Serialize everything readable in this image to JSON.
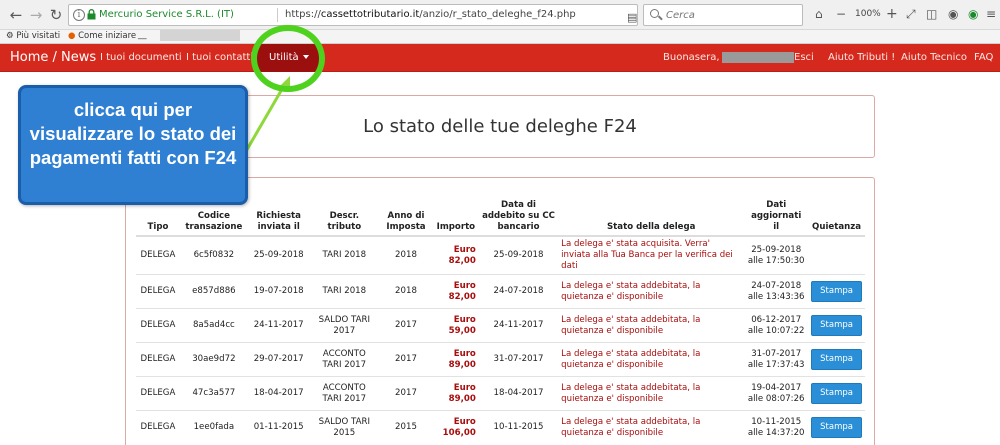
{
  "browser": {
    "site_identity": "Mercurio Service S.R.L. (IT)",
    "url_prefix": "https://",
    "url_host": "cassettotributario.it",
    "url_path": "/anzio/r_stato_deleghe_f24.php",
    "search_placeholder": "Cerca",
    "zoom": "100%",
    "bookmarks": [
      "Più visitati",
      "Come iniziare"
    ]
  },
  "navbar": {
    "brand": "Home / News",
    "documenti": "I tuoi documenti",
    "contatti": "I tuoi contatti",
    "utilita": "Utilità",
    "greeting": "Buonasera,",
    "esci": "Esci",
    "aiuto_tributi": "Aiuto Tributi !",
    "aiuto_tecnico": "Aiuto Tecnico",
    "faq": "FAQ"
  },
  "page": {
    "title": "Lo stato delle tue deleghe F24"
  },
  "table": {
    "headers": [
      "Tipo",
      "Codice transazione",
      "Richiesta inviata il",
      "Descr. tributo",
      "Anno di Imposta",
      "Importo",
      "Data di addebito su CC bancario",
      "Stato della delega",
      "Dati aggiornati il",
      "Quietanza"
    ],
    "button_label": "Stampa",
    "rows": [
      {
        "tipo": "DELEGA",
        "codice": "6c5f0832",
        "richiesta": "25-09-2018",
        "descr": "TARI 2018",
        "anno": "2018",
        "importo_1": "Euro",
        "importo_2": "82,00",
        "addebito": "25-09-2018",
        "stato": "La delega e' stata acquisita. Verra' inviata alla Tua Banca per la verifica dei dati",
        "agg_1": "25-09-2018",
        "agg_2": "alle 17:50:30",
        "stampa": false
      },
      {
        "tipo": "DELEGA",
        "codice": "e857d886",
        "richiesta": "19-07-2018",
        "descr": "TARI 2018",
        "anno": "2018",
        "importo_1": "Euro",
        "importo_2": "82,00",
        "addebito": "24-07-2018",
        "stato": "La delega e' stata addebitata, la quietanza e' disponibile",
        "agg_1": "24-07-2018",
        "agg_2": "alle 13:43:36",
        "stampa": true
      },
      {
        "tipo": "DELEGA",
        "codice": "8a5ad4cc",
        "richiesta": "24-11-2017",
        "descr": "SALDO TARI 2017",
        "anno": "2017",
        "importo_1": "Euro",
        "importo_2": "59,00",
        "addebito": "24-11-2017",
        "stato": "La delega e' stata addebitata, la quietanza e' disponibile",
        "agg_1": "06-12-2017",
        "agg_2": "alle 10:07:22",
        "stampa": true
      },
      {
        "tipo": "DELEGA",
        "codice": "30ae9d72",
        "richiesta": "29-07-2017",
        "descr": "ACCONTO TARI 2017",
        "anno": "2017",
        "importo_1": "Euro",
        "importo_2": "89,00",
        "addebito": "31-07-2017",
        "stato": "La delega e' stata addebitata, la quietanza e' disponibile",
        "agg_1": "31-07-2017",
        "agg_2": "alle 17:37:43",
        "stampa": true
      },
      {
        "tipo": "DELEGA",
        "codice": "47c3a577",
        "richiesta": "18-04-2017",
        "descr": "ACCONTO TARI 2017",
        "anno": "2017",
        "importo_1": "Euro",
        "importo_2": "89,00",
        "addebito": "18-04-2017",
        "stato": "La delega e' stata addebitata, la quietanza e' disponibile",
        "agg_1": "19-04-2017",
        "agg_2": "alle 08:07:26",
        "stampa": true
      },
      {
        "tipo": "DELEGA",
        "codice": "1ee0fada",
        "richiesta": "01-11-2015",
        "descr": "SALDO TARI 2015",
        "anno": "2015",
        "importo_1": "Euro",
        "importo_2": "106,00",
        "addebito": "10-11-2015",
        "stato": "La delega e' stata addebitata, la quietanza e' disponibile",
        "agg_1": "10-11-2015",
        "agg_2": "alle 14:37:20",
        "stampa": true
      }
    ]
  },
  "annotation": {
    "callout": "clicca qui per visualizzare lo stato dei pagamenti fatti con F24"
  },
  "colors": {
    "navbar": "#d6291d",
    "active_menu": "#9b0f0f",
    "callout": "#2f7fd3",
    "highlight": "#4ed21d",
    "stato_text": "#a80d0d",
    "button": "#2a8fd6"
  }
}
